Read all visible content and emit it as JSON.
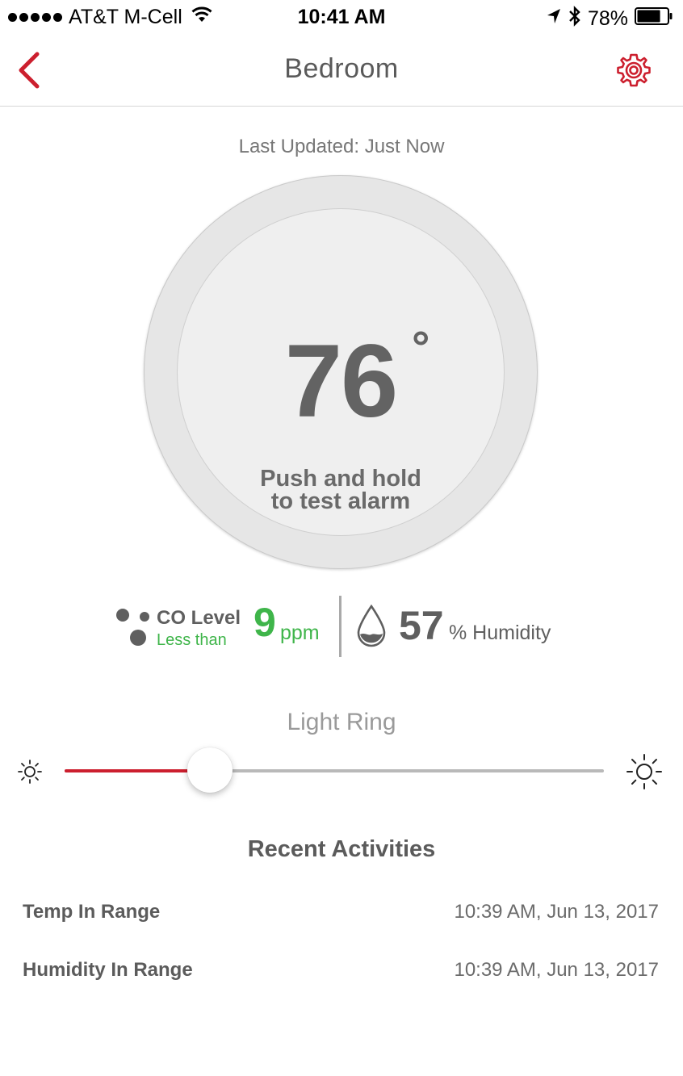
{
  "status_bar": {
    "carrier": "AT&T M-Cell",
    "time": "10:41 AM",
    "battery": "78%",
    "battery_level": 0.78,
    "icons": [
      "signal-dots-icon",
      "wifi-icon",
      "location-arrow-icon",
      "bluetooth-icon",
      "battery-icon"
    ]
  },
  "nav": {
    "title": "Bedroom",
    "back_icon": "chevron-left-icon",
    "settings_icon": "gear-icon",
    "accent_color": "#cc1f2e"
  },
  "last_updated": "Last Updated: Just Now",
  "ring": {
    "temperature": "76",
    "degree": "°",
    "hint_line1": "Push and hold",
    "hint_line2": "to test alarm"
  },
  "co": {
    "label": "CO Level",
    "qualifier": "Less than",
    "value": "9",
    "unit": "ppm",
    "color": "#3fb54a",
    "icon": "co-molecule-icon"
  },
  "humidity": {
    "value": "57",
    "label": "% Humidity",
    "icon": "water-drop-icon"
  },
  "light_ring": {
    "label": "Light Ring",
    "level": 0.27,
    "min_icon": "sun-dim-icon",
    "max_icon": "sun-bright-icon"
  },
  "activities": {
    "title": "Recent Activities",
    "items": [
      {
        "name": "Temp In Range",
        "time": "10:39 AM, Jun 13, 2017"
      },
      {
        "name": "Humidity In Range",
        "time": "10:39 AM, Jun 13, 2017"
      }
    ]
  }
}
